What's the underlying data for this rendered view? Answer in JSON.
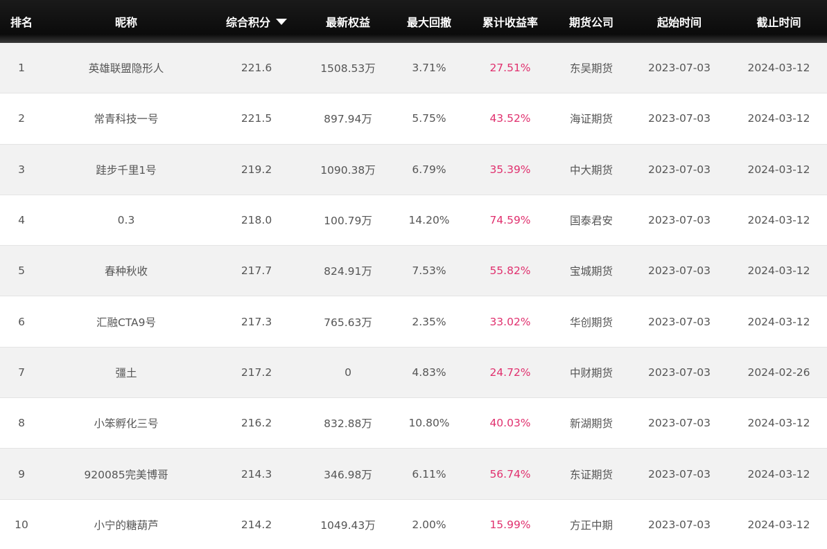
{
  "header": {
    "rank": "排名",
    "name": "昵称",
    "score": "综合积分",
    "equity": "最新权益",
    "drawdown": "最大回撤",
    "return": "累计收益率",
    "company": "期货公司",
    "start": "起始时间",
    "end": "截止时间"
  },
  "colors": {
    "header_bg": "#0b0b0b",
    "return_text": "#e0306e",
    "row_alt_bg": "#f2f2f2"
  },
  "rows": [
    {
      "rank": "1",
      "name": "英雄联盟隐形人",
      "score": "221.6",
      "equity": "1508.53万",
      "drawdown": "3.71%",
      "return": "27.51%",
      "company": "东吴期货",
      "start": "2023-07-03",
      "end": "2024-03-12"
    },
    {
      "rank": "2",
      "name": "常青科技一号",
      "score": "221.5",
      "equity": "897.94万",
      "drawdown": "5.75%",
      "return": "43.52%",
      "company": "海证期货",
      "start": "2023-07-03",
      "end": "2024-03-12"
    },
    {
      "rank": "3",
      "name": "跬步千里1号",
      "score": "219.2",
      "equity": "1090.38万",
      "drawdown": "6.79%",
      "return": "35.39%",
      "company": "中大期货",
      "start": "2023-07-03",
      "end": "2024-03-12"
    },
    {
      "rank": "4",
      "name": "0.3",
      "score": "218.0",
      "equity": "100.79万",
      "drawdown": "14.20%",
      "return": "74.59%",
      "company": "国泰君安",
      "start": "2023-07-03",
      "end": "2024-03-12"
    },
    {
      "rank": "5",
      "name": "春种秋收",
      "score": "217.7",
      "equity": "824.91万",
      "drawdown": "7.53%",
      "return": "55.82%",
      "company": "宝城期货",
      "start": "2023-07-03",
      "end": "2024-03-12"
    },
    {
      "rank": "6",
      "name": "汇融CTA9号",
      "score": "217.3",
      "equity": "765.63万",
      "drawdown": "2.35%",
      "return": "33.02%",
      "company": "华创期货",
      "start": "2023-07-03",
      "end": "2024-03-12"
    },
    {
      "rank": "7",
      "name": "彊土",
      "score": "217.2",
      "equity": "0",
      "drawdown": "4.83%",
      "return": "24.72%",
      "company": "中财期货",
      "start": "2023-07-03",
      "end": "2024-02-26"
    },
    {
      "rank": "8",
      "name": "小笨孵化三号",
      "score": "216.2",
      "equity": "832.88万",
      "drawdown": "10.80%",
      "return": "40.03%",
      "company": "新湖期货",
      "start": "2023-07-03",
      "end": "2024-03-12"
    },
    {
      "rank": "9",
      "name": "920085完美博哥",
      "score": "214.3",
      "equity": "346.98万",
      "drawdown": "6.11%",
      "return": "56.74%",
      "company": "东证期货",
      "start": "2023-07-03",
      "end": "2024-03-12"
    },
    {
      "rank": "10",
      "name": "小宁的糖葫芦",
      "score": "214.2",
      "equity": "1049.43万",
      "drawdown": "2.00%",
      "return": "15.99%",
      "company": "方正中期",
      "start": "2023-07-03",
      "end": "2024-03-12"
    }
  ]
}
